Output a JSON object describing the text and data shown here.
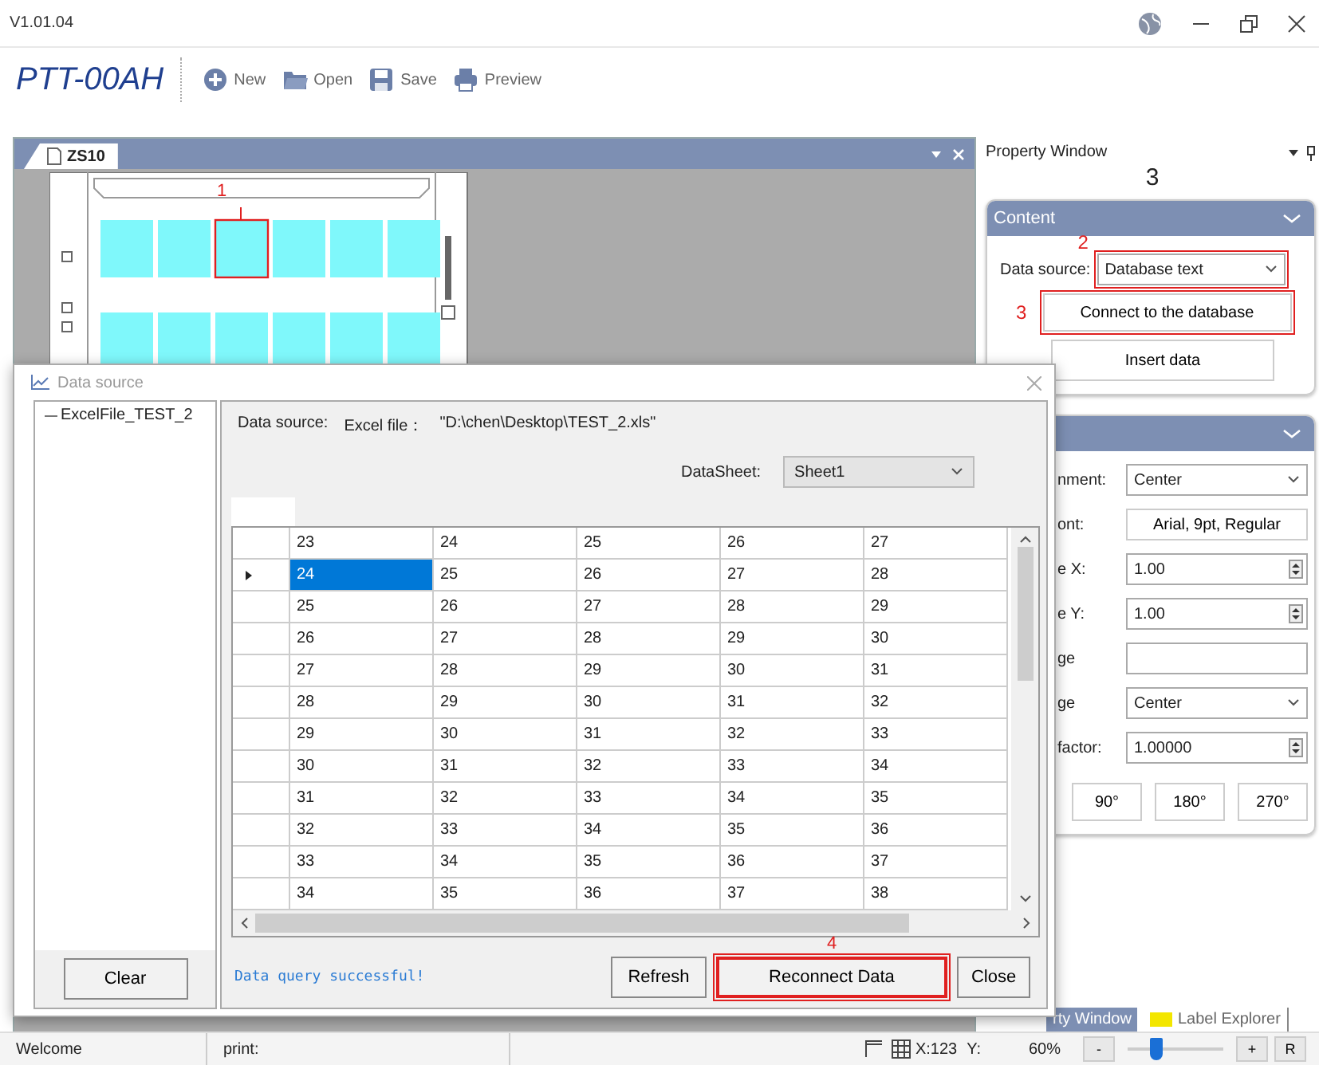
{
  "title_bar": {
    "version": "V1.01.04"
  },
  "toolbar": {
    "app_name": "PTT-00AH",
    "buttons": [
      {
        "label": "New",
        "kind": "new"
      },
      {
        "label": "Open",
        "kind": "open"
      },
      {
        "label": "Save",
        "kind": "save"
      },
      {
        "label": "Preview",
        "kind": "preview"
      }
    ]
  },
  "document": {
    "tabs": [
      {
        "label": "ZS10",
        "selected": true
      }
    ],
    "annotation": "1"
  },
  "property_window": {
    "title": "Property Window",
    "step": "3",
    "content": {
      "title": "Content",
      "data_source_label": "Data source:",
      "data_source_value": "Database text",
      "data_source_annotation": "2",
      "connect_annotation": "3",
      "connect_button": "Connect to the database",
      "insert_button": "Insert data"
    },
    "properties": {
      "rows": [
        {
          "kind": "select",
          "label": "nment:",
          "value": "Center"
        },
        {
          "kind": "button",
          "label": "ont:",
          "value": "Arial, 9pt, Regular"
        },
        {
          "kind": "spin",
          "label": "e X:",
          "value": "1.00"
        },
        {
          "kind": "spin",
          "label": "e Y:",
          "value": "1.00"
        },
        {
          "kind": "text",
          "label": "ge"
        },
        {
          "kind": "select",
          "label": "ge",
          "value": "Center"
        },
        {
          "kind": "spin",
          "label": "factor:",
          "value": "1.00000"
        }
      ],
      "rotation_buttons": [
        "90°",
        "180°",
        "270°"
      ]
    },
    "bottom_tabs": [
      {
        "label": "rty Window",
        "selected": true
      },
      {
        "label": "Label Explorer",
        "selected": false
      }
    ]
  },
  "dialog": {
    "title": "Data source",
    "tree": [
      {
        "label": "ExcelFile_TEST_2"
      }
    ],
    "clear_button": "Clear",
    "source_label": "Data source:",
    "file_label": "Excel file：",
    "file_path": "\"D:\\chen\\Desktop\\TEST_2.xls\"",
    "datasheet_label": "DataSheet:",
    "datasheet_value": "Sheet1",
    "table": {
      "columns": [
        "23",
        "24",
        "25",
        "26",
        "27"
      ],
      "rows": [
        {
          "selected": true,
          "cells": [
            "24",
            "25",
            "26",
            "27",
            "28"
          ]
        },
        {
          "selected": false,
          "cells": [
            "25",
            "26",
            "27",
            "28",
            "29"
          ]
        },
        {
          "selected": false,
          "cells": [
            "26",
            "27",
            "28",
            "29",
            "30"
          ]
        },
        {
          "selected": false,
          "cells": [
            "27",
            "28",
            "29",
            "30",
            "31"
          ]
        },
        {
          "selected": false,
          "cells": [
            "28",
            "29",
            "30",
            "31",
            "32"
          ]
        },
        {
          "selected": false,
          "cells": [
            "29",
            "30",
            "31",
            "32",
            "33"
          ]
        },
        {
          "selected": false,
          "cells": [
            "30",
            "31",
            "32",
            "33",
            "34"
          ]
        },
        {
          "selected": false,
          "cells": [
            "31",
            "32",
            "33",
            "34",
            "35"
          ]
        },
        {
          "selected": false,
          "cells": [
            "32",
            "33",
            "34",
            "35",
            "36"
          ]
        },
        {
          "selected": false,
          "cells": [
            "33",
            "34",
            "35",
            "36",
            "37"
          ]
        },
        {
          "selected": false,
          "cells": [
            "34",
            "35",
            "36",
            "37",
            "38"
          ]
        }
      ]
    },
    "message": "Data query successful!",
    "buttons": [
      {
        "label": "Refresh",
        "highlighted": false
      },
      {
        "label": "Reconnect Data",
        "highlighted": true,
        "annotation": "4"
      },
      {
        "label": "Close",
        "highlighted": false
      }
    ]
  },
  "status_bar": {
    "welcome": "Welcome",
    "print_label": "print:",
    "x_coord": "X:123",
    "y_coord": "Y:",
    "zoom": "60%",
    "zoom_out": "-",
    "zoom_in": "+",
    "reset": "R",
    "zoom_slider": {
      "level": 0.3
    }
  }
}
